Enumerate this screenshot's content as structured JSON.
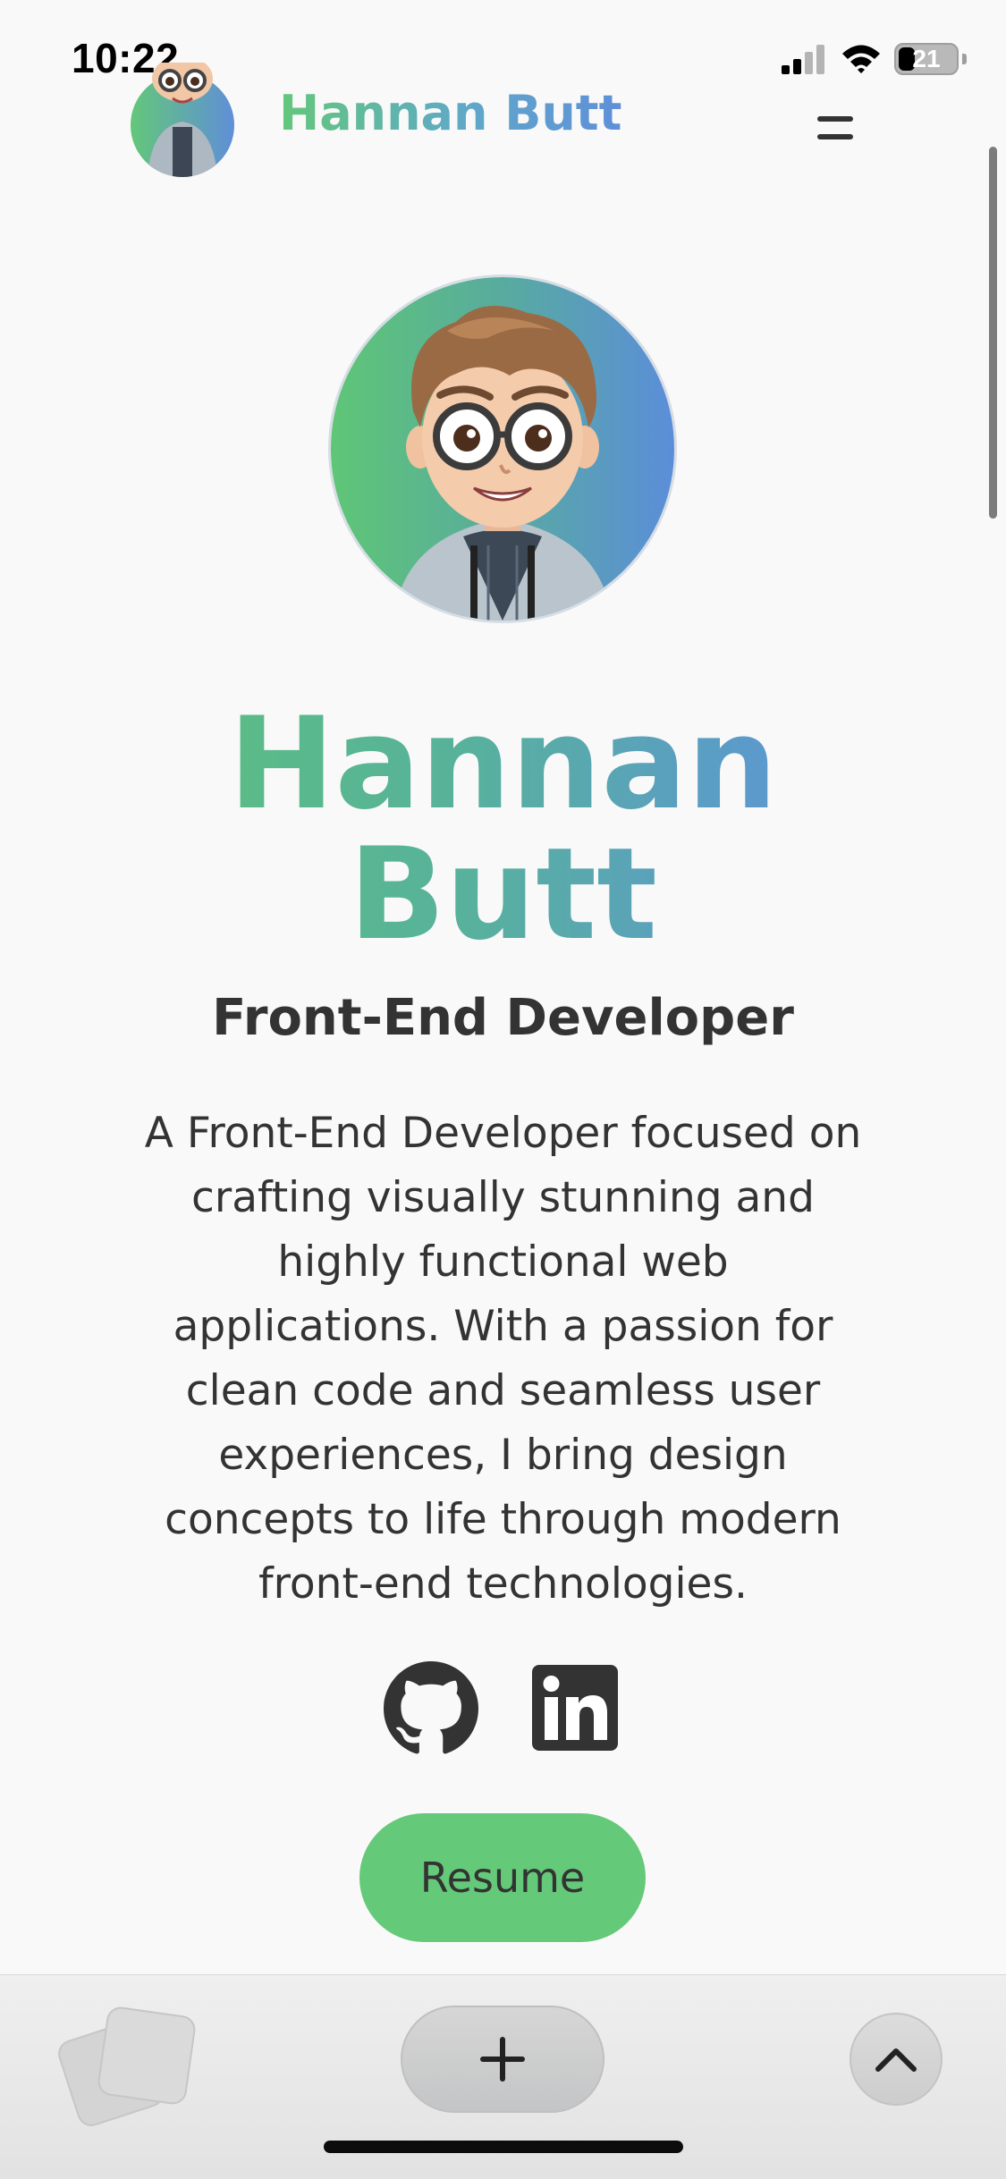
{
  "status_bar": {
    "time": "10:22",
    "battery_level": "21",
    "signal_bars": 2,
    "icons": [
      "signal-icon",
      "wifi-icon",
      "battery-icon"
    ]
  },
  "header": {
    "brand": "Hannan Butt",
    "avatar_icon": "avatar-icon",
    "menu_icon": "menu-icon"
  },
  "hero": {
    "name_line1": "Hannan",
    "name_line2": "Butt",
    "title": "Front-End Developer",
    "bio": "A Front-End Developer focused on crafting visually stunning and highly functional web applications. With a passion for clean code and seamless user experiences, I bring design concepts to life through modern front-end technologies.",
    "avatar_icon": "cartoon-avatar-icon"
  },
  "socials": [
    {
      "name": "GitHub",
      "icon": "github-icon"
    },
    {
      "name": "LinkedIn",
      "icon": "linkedin-icon"
    }
  ],
  "resume_label": "Resume",
  "browser_toolbar": {
    "icons": [
      "tabs-icon",
      "plus-icon",
      "chevron-up-icon"
    ]
  },
  "colors": {
    "background": "#f9f9f9",
    "gradient_start": "#5cc573",
    "gradient_end": "#5d8fd8",
    "text": "#333333",
    "resume_button": "#64c978"
  }
}
